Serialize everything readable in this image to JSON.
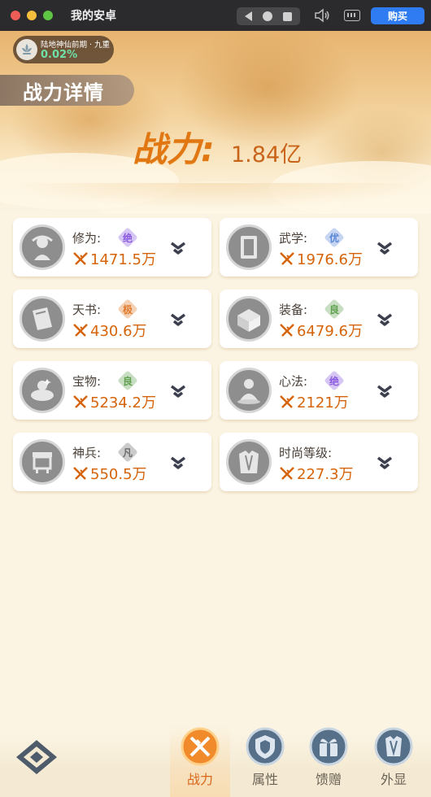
{
  "window": {
    "title": "我的安卓",
    "buy_label": "购买",
    "controls": [
      "back-icon",
      "home-icon",
      "recent-apps-icon",
      "volume-icon",
      "keyboard-icon"
    ]
  },
  "realm": {
    "name": "陆地神仙前期 · 九重",
    "progress": "0.02%"
  },
  "section_title": "战力详情",
  "total_power": {
    "label": "战力:",
    "value": "1.84亿"
  },
  "cards": [
    {
      "label": "修为:",
      "grade": "绝",
      "grade_color": "#8a5be0",
      "value": "1471.5万",
      "icon": "cultivator-icon"
    },
    {
      "label": "武学:",
      "grade": "优",
      "grade_color": "#5b86d8",
      "value": "1976.6万",
      "icon": "manual-book-icon"
    },
    {
      "label": "天书:",
      "grade": "极",
      "grade_color": "#e07a2a",
      "value": "430.6万",
      "icon": "heavenly-book-icon"
    },
    {
      "label": "装备:",
      "grade": "良",
      "grade_color": "#5fa050",
      "value": "6479.6万",
      "icon": "equipment-icon"
    },
    {
      "label": "宝物:",
      "grade": "良",
      "grade_color": "#5fa050",
      "value": "5234.2万",
      "icon": "treasure-icon"
    },
    {
      "label": "心法:",
      "grade": "绝",
      "grade_color": "#8a5be0",
      "value": "2121万",
      "icon": "mind-method-icon"
    },
    {
      "label": "神兵:",
      "grade": "凡",
      "grade_color": "#6b6b6b",
      "value": "550.5万",
      "icon": "divine-weapon-icon"
    },
    {
      "label": "时尚等级:",
      "grade": "",
      "grade_color": "",
      "value": "227.3万",
      "icon": "fashion-icon"
    }
  ],
  "nav": [
    {
      "label": "战力",
      "icon": "crossed-swords-icon",
      "active": true
    },
    {
      "label": "属性",
      "icon": "attribute-shield-icon",
      "active": false
    },
    {
      "label": "馈赠",
      "icon": "gift-icon",
      "active": false
    },
    {
      "label": "外显",
      "icon": "appearance-icon",
      "active": false
    }
  ]
}
